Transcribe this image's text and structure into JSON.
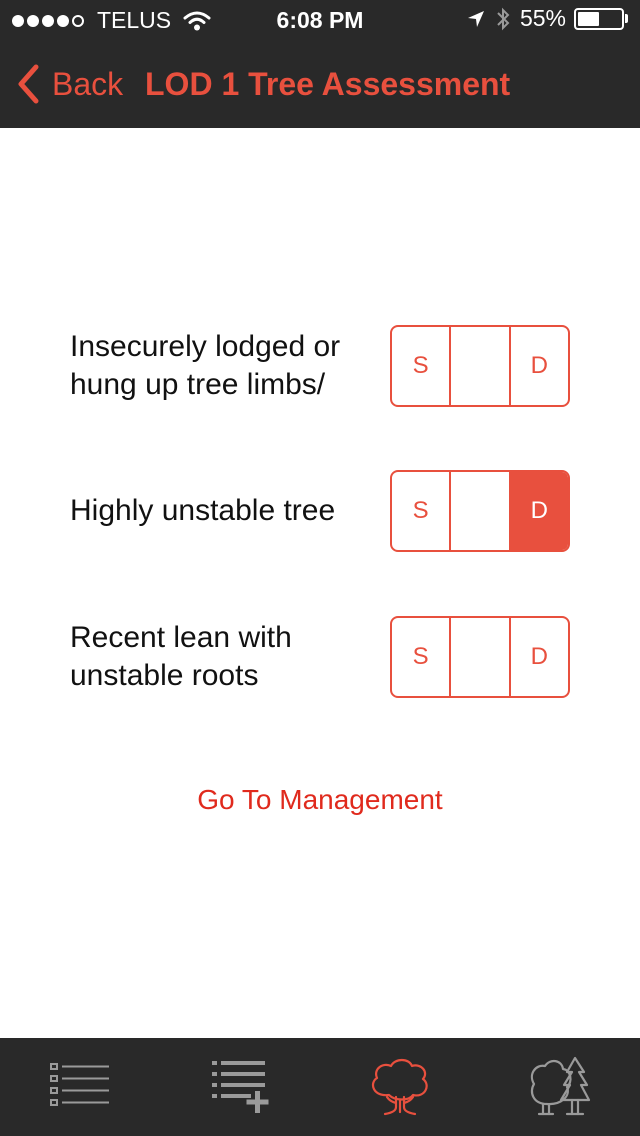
{
  "status_bar": {
    "carrier": "TELUS",
    "time": "6:08 PM",
    "battery_percent": "55%",
    "battery_level": 0.55,
    "signal_bars_filled": 4,
    "signal_bars_total": 5
  },
  "nav": {
    "back_label": "Back",
    "title": "LOD 1 Tree Assessment"
  },
  "rows": [
    {
      "label": "Insecurely lodged or hung up tree limbs/",
      "options": [
        "S",
        "",
        "D"
      ],
      "selected": null
    },
    {
      "label": "Highly unstable tree",
      "options": [
        "S",
        "",
        "D"
      ],
      "selected": "D"
    },
    {
      "label": "Recent lean with unstable roots",
      "options": [
        "S",
        "",
        "D"
      ],
      "selected": null
    }
  ],
  "management_link": "Go To Management",
  "tabs": [
    {
      "icon": "list-icon",
      "active": false
    },
    {
      "icon": "list-add-icon",
      "active": false
    },
    {
      "icon": "tree-icon",
      "active": true
    },
    {
      "icon": "forest-icon",
      "active": false
    }
  ],
  "colors": {
    "accent": "#e8503e",
    "link": "#e02a1d",
    "bar_background": "#292929",
    "tab_inactive": "#9a9a9a"
  }
}
